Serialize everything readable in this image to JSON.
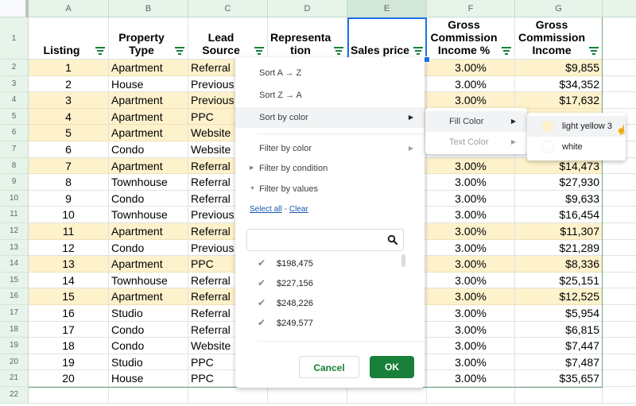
{
  "columns": [
    "A",
    "B",
    "C",
    "D",
    "E",
    "F",
    "G"
  ],
  "selected_column": "E",
  "header_row_number": "1",
  "headers": [
    "Listing",
    "Property Type",
    "Lead Source",
    "Representa tion",
    "Sales price",
    "Gross Commission Income %",
    "Gross Commission Income"
  ],
  "headers_display": [
    [
      "Listing"
    ],
    [
      "Property",
      "Type"
    ],
    [
      "Lead",
      "Source"
    ],
    [
      "Representa",
      "tion"
    ],
    [
      "Sales price"
    ],
    [
      "Gross",
      "Commission",
      "Income %"
    ],
    [
      "Gross",
      "Commission",
      "Income"
    ]
  ],
  "rows": [
    {
      "row": "2",
      "listing": "1",
      "type": "Apartment",
      "source": "Referral",
      "pct": "3.00%",
      "gci": "$9,855",
      "fill": "light yellow 3"
    },
    {
      "row": "3",
      "listing": "2",
      "type": "House",
      "source": "Previous",
      "pct": "3.00%",
      "gci": "$34,352",
      "fill": "white"
    },
    {
      "row": "4",
      "listing": "3",
      "type": "Apartment",
      "source": "Previous",
      "pct": "3.00%",
      "gci": "$17,632",
      "fill": "light yellow 3"
    },
    {
      "row": "5",
      "listing": "4",
      "type": "Apartment",
      "source": "PPC",
      "pct": "",
      "gci": "",
      "fill": "light yellow 3"
    },
    {
      "row": "6",
      "listing": "5",
      "type": "Apartment",
      "source": "Website",
      "pct": "",
      "gci": "",
      "fill": "light yellow 3"
    },
    {
      "row": "7",
      "listing": "6",
      "type": "Condo",
      "source": "Website",
      "pct": "",
      "gci": "",
      "fill": "white"
    },
    {
      "row": "8",
      "listing": "7",
      "type": "Apartment",
      "source": "Referral",
      "pct": "3.00%",
      "gci": "$14,473",
      "fill": "light yellow 3"
    },
    {
      "row": "9",
      "listing": "8",
      "type": "Townhouse",
      "source": "Referral",
      "pct": "3.00%",
      "gci": "$27,930",
      "fill": "white"
    },
    {
      "row": "10",
      "listing": "9",
      "type": "Condo",
      "source": "Referral",
      "pct": "3.00%",
      "gci": "$9,633",
      "fill": "white"
    },
    {
      "row": "11",
      "listing": "10",
      "type": "Townhouse",
      "source": "Previous",
      "pct": "3.00%",
      "gci": "$16,454",
      "fill": "white"
    },
    {
      "row": "12",
      "listing": "11",
      "type": "Apartment",
      "source": "Referral",
      "pct": "3.00%",
      "gci": "$11,307",
      "fill": "light yellow 3"
    },
    {
      "row": "13",
      "listing": "12",
      "type": "Condo",
      "source": "Previous",
      "pct": "3.00%",
      "gci": "$21,289",
      "fill": "white"
    },
    {
      "row": "14",
      "listing": "13",
      "type": "Apartment",
      "source": "PPC",
      "pct": "3.00%",
      "gci": "$8,336",
      "fill": "light yellow 3"
    },
    {
      "row": "15",
      "listing": "14",
      "type": "Townhouse",
      "source": "Referral",
      "pct": "3.00%",
      "gci": "$25,151",
      "fill": "white"
    },
    {
      "row": "16",
      "listing": "15",
      "type": "Apartment",
      "source": "Referral",
      "pct": "3.00%",
      "gci": "$12,525",
      "fill": "light yellow 3"
    },
    {
      "row": "17",
      "listing": "16",
      "type": "Studio",
      "source": "Referral",
      "pct": "3.00%",
      "gci": "$5,954",
      "fill": "white"
    },
    {
      "row": "18",
      "listing": "17",
      "type": "Condo",
      "source": "Referral",
      "pct": "3.00%",
      "gci": "$6,815",
      "fill": "white"
    },
    {
      "row": "19",
      "listing": "18",
      "type": "Condo",
      "source": "Website",
      "pct": "3.00%",
      "gci": "$7,447",
      "fill": "white"
    },
    {
      "row": "20",
      "listing": "19",
      "type": "Studio",
      "source": "PPC",
      "pct": "3.00%",
      "gci": "$7,487",
      "fill": "white"
    },
    {
      "row": "21",
      "listing": "20",
      "type": "House",
      "source": "PPC",
      "pct": "3.00%",
      "gci": "$35,657",
      "fill": "white"
    },
    {
      "row": "22",
      "listing": "",
      "type": "",
      "source": "",
      "pct": "",
      "gci": "",
      "fill": "white"
    }
  ],
  "colors": {
    "light_yellow_3": "#fef2cc",
    "white": "#ffffff",
    "accent_green": "#188038",
    "selection_blue": "#1a73e8",
    "header_green": "#e6f4ea"
  },
  "filter_menu": {
    "sort_az": "Sort A → Z",
    "sort_za": "Sort Z → A",
    "sort_by_color": "Sort by color",
    "filter_by_color": "Filter by color",
    "filter_by_condition": "Filter by condition",
    "filter_by_values": "Filter by values",
    "select_all": "Select all",
    "separator": "-",
    "clear": "Clear",
    "search_placeholder": "",
    "values": [
      "$198,475",
      "$227,156",
      "$248,226",
      "$249,577"
    ],
    "cancel_label": "Cancel",
    "ok_label": "OK"
  },
  "sort_by_color_submenu": {
    "fill_color": "Fill Color",
    "text_color": "Text Color"
  },
  "fill_color_submenu": {
    "items": [
      {
        "label": "light yellow 3",
        "color": "#fef2cc"
      },
      {
        "label": "white",
        "color": "#ffffff"
      }
    ]
  }
}
